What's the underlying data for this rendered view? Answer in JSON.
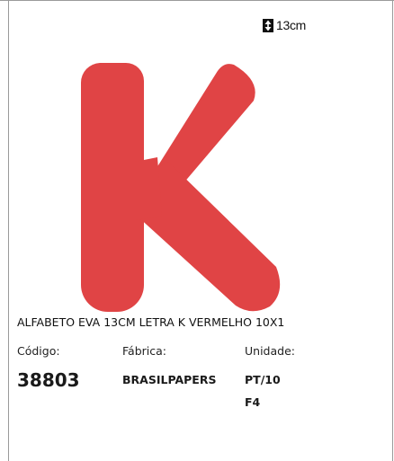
{
  "size_label": "13cm",
  "letter_color": "#e04445",
  "product": {
    "description": "ALFABETO EVA 13CM LETRA K VERMELHO 10X1",
    "codigo_label": "Código:",
    "codigo_value": "38803",
    "fabrica_label": "Fábrica:",
    "fabrica_value": "BRASILPAPERS",
    "unidade_label": "Unidade:",
    "unidade_value": "PT/10",
    "unidade_extra": "F4"
  }
}
